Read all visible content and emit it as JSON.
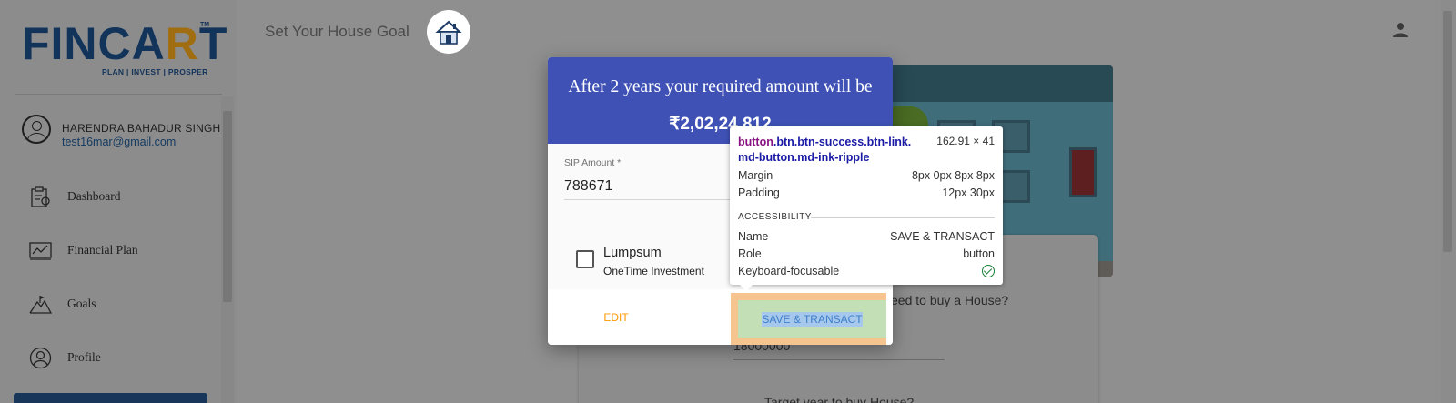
{
  "logo": {
    "wordmark": "FINCART",
    "tm": "TM",
    "tagline": "PLAN | INVEST | PROSPER"
  },
  "user": {
    "name": "HARENDRA BAHADUR SINGH",
    "email": "test16mar@gmail.com"
  },
  "sidebar": {
    "items": [
      {
        "label": "Dashboard",
        "icon": "dashboard-clipboard-icon"
      },
      {
        "label": "Financial Plan",
        "icon": "chart-icon"
      },
      {
        "label": "Goals",
        "icon": "mountain-flag-icon"
      },
      {
        "label": "Profile",
        "icon": "profile-icon"
      }
    ]
  },
  "header": {
    "title": "Set Your House Goal",
    "goal_icon": "house-icon",
    "user_icon": "person-icon"
  },
  "card": {
    "question_1": "eed to buy a House?",
    "value_1": "18000000",
    "question_2": "Target year to buy House?"
  },
  "modal": {
    "title": "After 2 years your required amount will be",
    "amount": "₹2,02,24,812",
    "sip_label": "SIP Amount *",
    "sip_value": "788671",
    "lumpsum_label": "Lumpsum",
    "lumpsum_sub": "OneTime Investment",
    "lumpsum_checked": false,
    "edit_label": "EDIT",
    "save_label": "SAVE & TRANSACT"
  },
  "devtools_tooltip": {
    "element": "button",
    "classes": ".btn.btn-success.btn-link.\nmd-button.md-ink-ripple",
    "size": "162.91 × 41",
    "margin_label": "Margin",
    "margin": "8px 0px 8px 8px",
    "padding_label": "Padding",
    "padding": "12px 30px",
    "accessibility_heading": "ACCESSIBILITY",
    "name_label": "Name",
    "name": "SAVE & TRANSACT",
    "role_label": "Role",
    "role": "button",
    "focusable_label": "Keyboard-focusable",
    "focusable": true
  },
  "colors": {
    "modal_header": "#3f51b5",
    "edit_button": "#ff9800",
    "overlay": "#8f8f8f",
    "brand_navy": "#12335a"
  }
}
